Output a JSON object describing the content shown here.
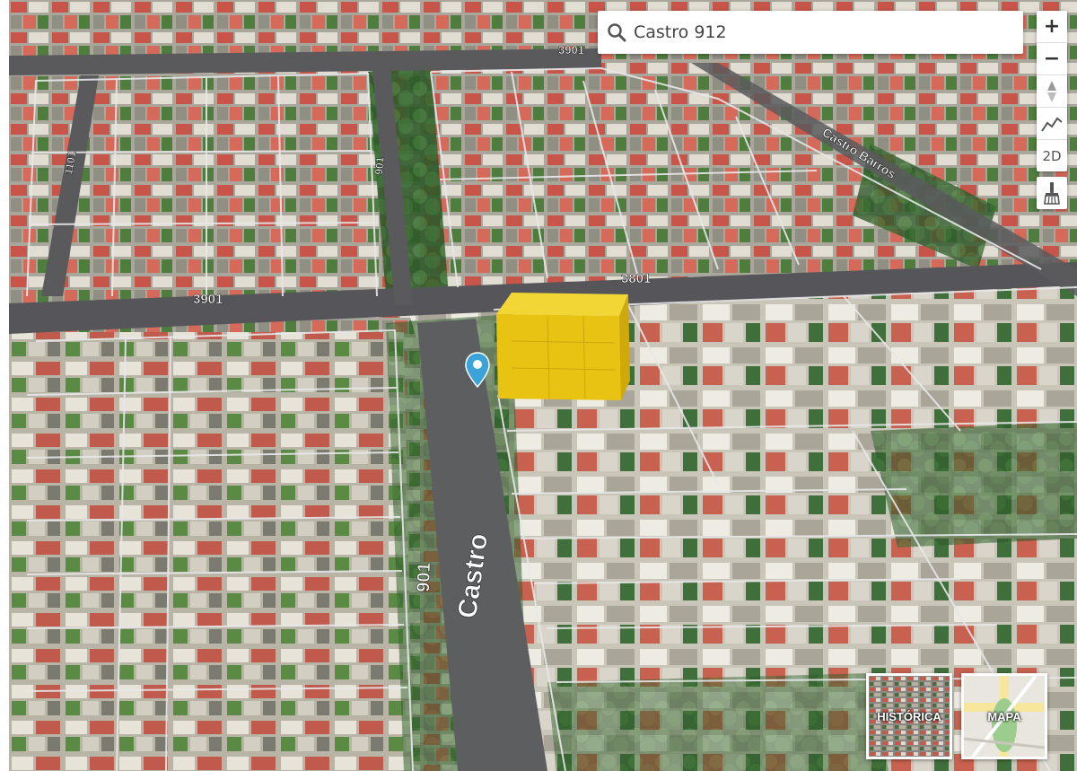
{
  "search": {
    "value": "Castro 912",
    "placeholder": ""
  },
  "controls": {
    "zoom_in": "+",
    "zoom_out": "−",
    "mode_2d": "2D"
  },
  "street_labels": {
    "castro": "Castro",
    "castro_number": "901",
    "cross_west_number": "3901",
    "cross_east_number": "3801",
    "upper_cross_number": "3901",
    "upper_left_street_number": "1101",
    "upper_mid_street_number": "901",
    "diagonal_street": "Castro Barros"
  },
  "layers": [
    {
      "label": "HISTÓRICA",
      "active": false
    },
    {
      "label": "MAPA",
      "active": false
    }
  ],
  "icons": {
    "search": "search-icon",
    "compass": "compass-icon",
    "elevation": "elevation-profile-icon",
    "clear": "broom-icon",
    "pin": "location-pin-icon"
  },
  "colors": {
    "highlight_block": "#e8c312",
    "pin": "#3ba3d9"
  }
}
